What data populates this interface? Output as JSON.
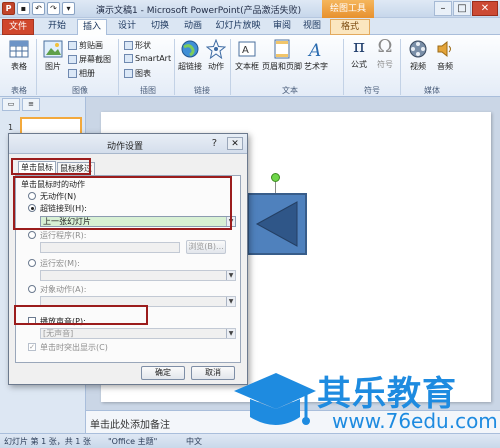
{
  "window": {
    "title": "演示文稿1 - Microsoft PowerPoint(产品激活失败)",
    "context_group": "绘图工具",
    "close_glyph": "✕",
    "min_glyph": "–",
    "max_glyph": "□"
  },
  "tabs": [
    {
      "label": "文件"
    },
    {
      "label": "开始"
    },
    {
      "label": "插入"
    },
    {
      "label": "设计"
    },
    {
      "label": "切换"
    },
    {
      "label": "动画"
    },
    {
      "label": "幻灯片放映"
    },
    {
      "label": "审阅"
    },
    {
      "label": "视图"
    },
    {
      "label": "格式"
    }
  ],
  "ribbon": {
    "table": "表格",
    "picture": "图片",
    "clipart": "剪贴画",
    "screenshot": "屏幕截图",
    "album": "相册",
    "shapes": "形状",
    "smartart": "SmartArt",
    "chart": "图表",
    "hyperlink": "超链接",
    "action": "动作",
    "textbox": "文本框",
    "header_footer": "页眉和页脚",
    "wordart": "艺术字",
    "formula": "公式",
    "symbol": "符号",
    "video": "视频",
    "audio": "音频",
    "groups": {
      "tables": "表格",
      "images": "图像",
      "illustrations": "插图",
      "links": "链接",
      "text": "文本",
      "symbols": "符号",
      "media": "媒体"
    }
  },
  "left_pane": {
    "slide_number": "1"
  },
  "notes": {
    "placeholder": "单击此处添加备注"
  },
  "status": {
    "slide": "幻灯片 第 1 张，共 1 张",
    "theme": "\"Office 主题\"",
    "lang": "中文"
  },
  "dialog": {
    "title": "动作设置",
    "help": "?",
    "close": "✕",
    "tabs": [
      "单击鼠标",
      "鼠标移过"
    ],
    "section": "单击鼠标时的动作",
    "options": {
      "none": "无动作(N)",
      "hyperlink": "超链接到(H):",
      "run_program": "运行程序(R):",
      "run_macro": "运行宏(M):",
      "object_action": "对象动作(A):"
    },
    "hyperlink_value": "上一张幻灯片",
    "browse": "浏览(B)...",
    "play_sound": "播放声音(P):",
    "sound_value": "[无声音]",
    "highlight_click": "单击时突出显示(C)",
    "ok": "确定",
    "cancel": "取消"
  },
  "watermark": {
    "brand": "其乐教育",
    "url": "www.76edu.com"
  },
  "colors": {
    "shape_fill": "#4f81bd",
    "shape_border": "#385d8a",
    "highlight": "#9b1c1c",
    "watermark": "#1e8be0"
  }
}
